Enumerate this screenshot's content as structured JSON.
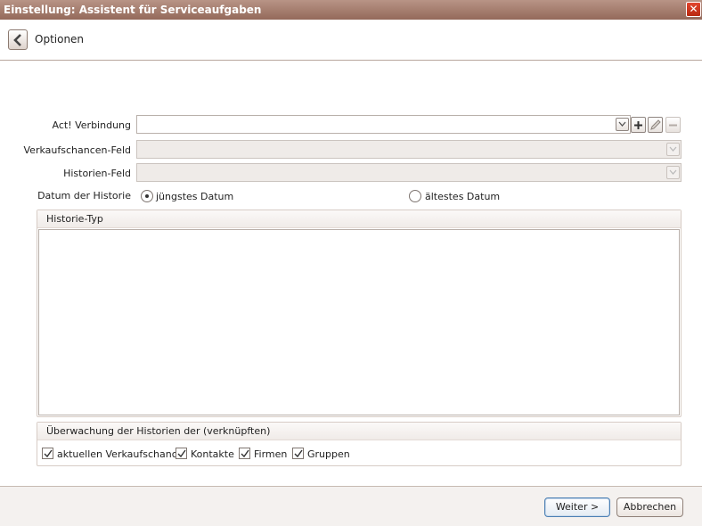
{
  "window": {
    "title": "Einstellung: Assistent für Serviceaufgaben",
    "close_symbol": "✕"
  },
  "header": {
    "title": "Optionen"
  },
  "form": {
    "connection": {
      "label": "Act! Verbindung",
      "value": ""
    },
    "opportunity_field": {
      "label": "Verkaufschancen-Feld",
      "value": ""
    },
    "history_field": {
      "label": "Historien-Feld",
      "value": ""
    },
    "history_date": {
      "label": "Datum der Historie",
      "options": [
        {
          "label": "jüngstes Datum",
          "selected": true
        },
        {
          "label": "ältestes Datum",
          "selected": false
        }
      ]
    }
  },
  "history_type": {
    "title": "Historie-Typ",
    "items": []
  },
  "monitoring": {
    "title": "Überwachung der Historien der (verknüpften)",
    "checks": [
      {
        "label": "aktuellen Verkaufschance",
        "checked": true
      },
      {
        "label": "Kontakte",
        "checked": true
      },
      {
        "label": "Firmen",
        "checked": true
      },
      {
        "label": "Gruppen",
        "checked": true
      }
    ]
  },
  "buttons": {
    "next": "Weiter >",
    "cancel": "Abbrechen"
  }
}
